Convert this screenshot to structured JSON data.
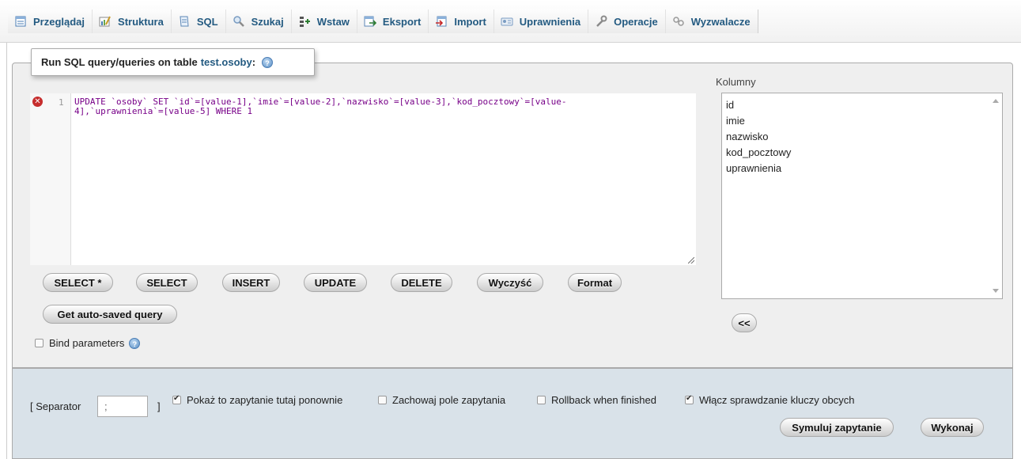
{
  "tabs": [
    {
      "label": "Przeglądaj",
      "icon": "browse-icon"
    },
    {
      "label": "Struktura",
      "icon": "structure-icon"
    },
    {
      "label": "SQL",
      "icon": "sql-icon"
    },
    {
      "label": "Szukaj",
      "icon": "search-icon"
    },
    {
      "label": "Wstaw",
      "icon": "insert-icon"
    },
    {
      "label": "Eksport",
      "icon": "export-icon"
    },
    {
      "label": "Import",
      "icon": "import-icon"
    },
    {
      "label": "Uprawnienia",
      "icon": "privileges-icon"
    },
    {
      "label": "Operacje",
      "icon": "operations-icon"
    },
    {
      "label": "Wyzwalacze",
      "icon": "triggers-icon"
    }
  ],
  "legend": {
    "prefix": "Run SQL query/queries on table",
    "table": "test.osoby",
    "suffix": ":"
  },
  "editor": {
    "line_number": "1",
    "line1": "UPDATE `osoby` SET `id`=[value-1],`imie`=[value-2],`nazwisko`=[value-3],`kod_pocztowy`=[value-",
    "line2": "4],`uprawnienia`=[value-5] WHERE 1"
  },
  "query_buttons": [
    "SELECT *",
    "SELECT",
    "INSERT",
    "UPDATE",
    "DELETE",
    "Wyczyść",
    "Format"
  ],
  "autosave_button": "Get auto-saved query",
  "bind_parameters": "Bind parameters",
  "columns": {
    "heading": "Kolumny",
    "items": [
      "id",
      "imie",
      "nazwisko",
      "kod_pocztowy",
      "uprawnienia"
    ],
    "insert_button": "<<"
  },
  "footer": {
    "separator_open": "[ Separator",
    "separator_value": ";",
    "separator_close": "]",
    "show_query": "Pokaż to zapytanie tutaj ponownie",
    "retain_box": "Zachowaj pole zapytania",
    "rollback": "Rollback when finished",
    "fk_checks": "Włącz sprawdzanie kluczy obcych",
    "simulate_button": "Symuluj zapytanie",
    "go_button": "Wykonaj"
  }
}
